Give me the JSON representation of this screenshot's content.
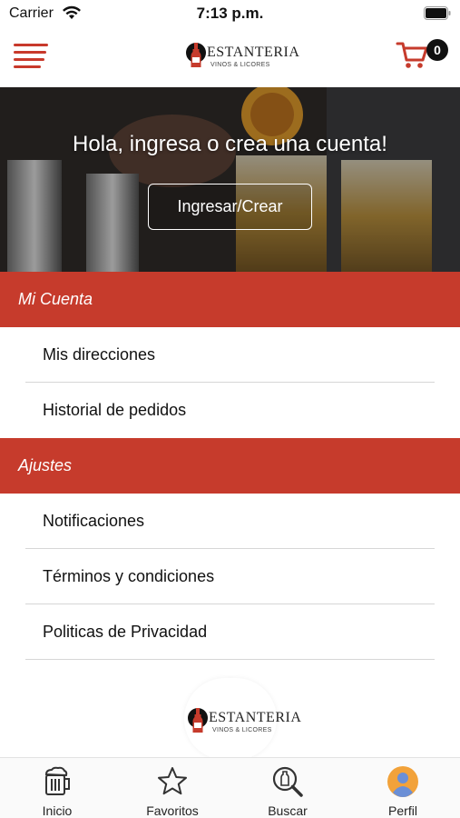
{
  "status_bar": {
    "carrier": "Carrier",
    "time": "7:13 p.m."
  },
  "header": {
    "logo_text": "ESTANTERIA",
    "logo_sub": "VINOS & LICORES",
    "cart_count": "0",
    "icons": [
      "menu-icon",
      "cart-icon"
    ]
  },
  "hero": {
    "title": "Hola, ingresa o crea una cuenta!",
    "button_label": "Ingresar/Crear"
  },
  "sections": [
    {
      "title": "Mi Cuenta",
      "items": [
        "Mis direcciones",
        "Historial de pedidos"
      ]
    },
    {
      "title": "Ajustes",
      "items": [
        "Notificaciones",
        "Términos y condiciones",
        "Politicas de Privacidad"
      ]
    }
  ],
  "footer": {
    "logo_text": "ESTANTERIA",
    "logo_sub": "VINOS & LICORES"
  },
  "tabbar": {
    "tabs": [
      {
        "label": "Inicio",
        "icon": "beer-mug-icon"
      },
      {
        "label": "Favoritos",
        "icon": "star-icon"
      },
      {
        "label": "Buscar",
        "icon": "search-bottle-icon"
      },
      {
        "label": "Perfil",
        "icon": "profile-avatar-icon"
      }
    ]
  },
  "colors": {
    "accent": "#c63b2c",
    "avatar": "#f2a23a"
  }
}
